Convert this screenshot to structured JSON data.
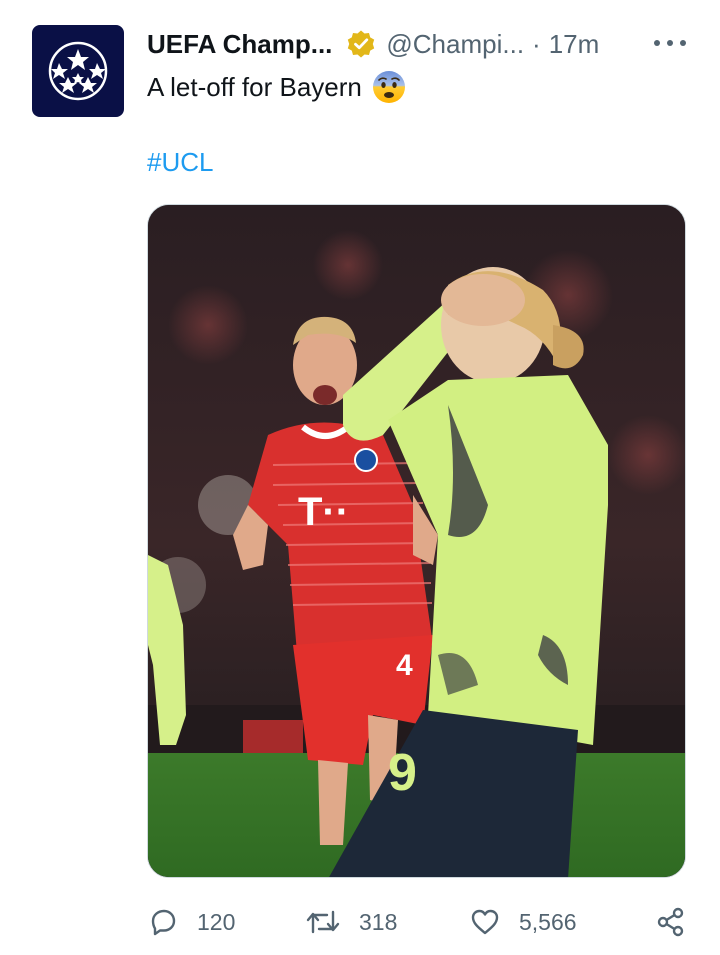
{
  "tweet": {
    "author": {
      "display_name": "UEFA Champ...",
      "handle": "@Champi...",
      "separator": "·",
      "time": "17m",
      "avatar_icon": "ucl-starball-logo",
      "verified_icon": "gold-verified-badge-icon"
    },
    "text": "A let-off for Bayern",
    "emoji": "fearful-face-emoji",
    "hashtag": "#UCL",
    "media": {
      "description_icon": "football-photo",
      "jersey_number": "9"
    },
    "actions": {
      "replies": "120",
      "retweets": "318",
      "likes": "5,566"
    }
  },
  "colors": {
    "link": "#1d9bf0",
    "muted": "#536471",
    "verified_gold": "#e2b719",
    "avatar_bg": "#0a1046"
  }
}
